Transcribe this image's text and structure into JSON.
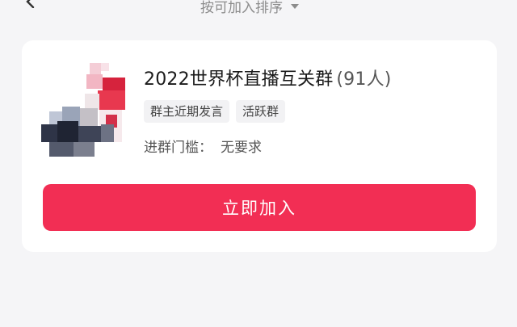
{
  "header": {
    "sort_label": "按可加入排序"
  },
  "group": {
    "name": "2022世界杯直播互关群",
    "member_count": "(91人)",
    "tags": [
      "群主近期发言",
      "活跃群"
    ],
    "requirement_label": "进群门槛：",
    "requirement_value": "无要求",
    "join_label": "立即加入"
  },
  "colors": {
    "accent": "#f22e54",
    "background": "#f5f5f7",
    "card": "#ffffff"
  }
}
